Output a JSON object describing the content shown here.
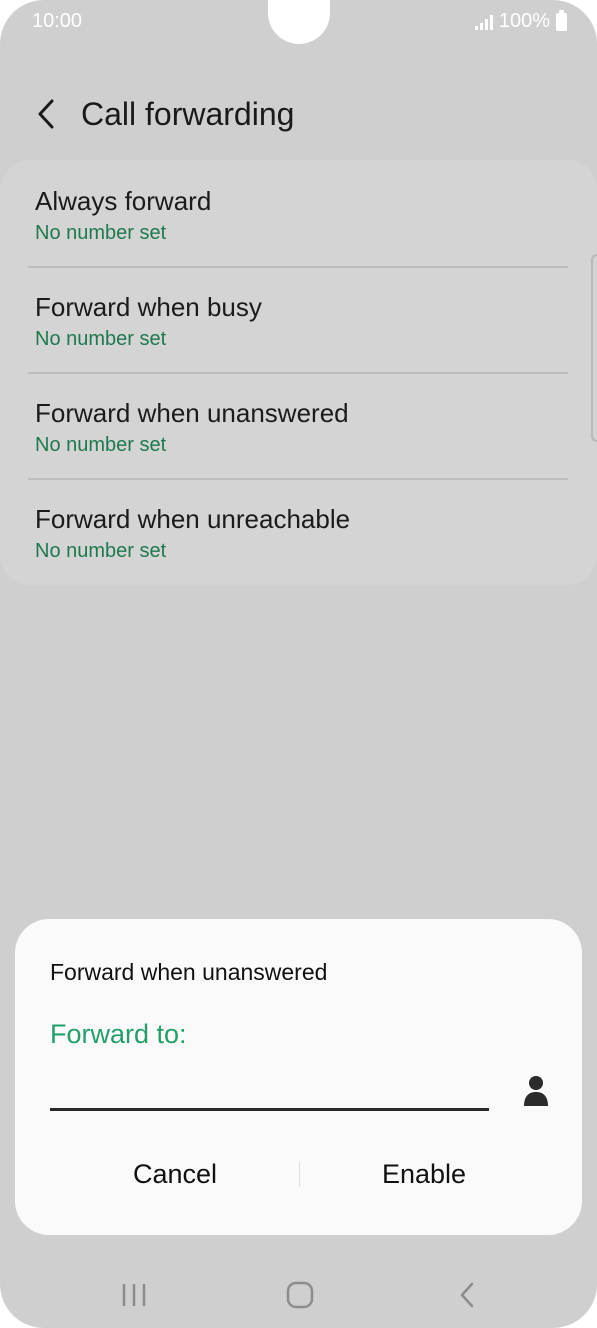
{
  "status": {
    "time": "10:00",
    "battery": "100%"
  },
  "header": {
    "title": "Call forwarding"
  },
  "options": [
    {
      "title": "Always forward",
      "subtitle": "No number set"
    },
    {
      "title": "Forward when busy",
      "subtitle": "No number set"
    },
    {
      "title": "Forward when unanswered",
      "subtitle": "No number set"
    },
    {
      "title": "Forward when unreachable",
      "subtitle": "No number set"
    }
  ],
  "dialog": {
    "title": "Forward when unanswered",
    "field_label": "Forward to:",
    "field_value": "",
    "cancel_label": "Cancel",
    "enable_label": "Enable"
  },
  "icons": {
    "back": "chevron-left-icon",
    "contact": "person-icon",
    "nav_recent": "recent-apps-icon",
    "nav_home": "home-icon",
    "nav_back": "back-icon"
  },
  "colors": {
    "accent": "#23a06a",
    "subtitle": "#1e7a4e",
    "dim_background": "#cfcfcf"
  }
}
